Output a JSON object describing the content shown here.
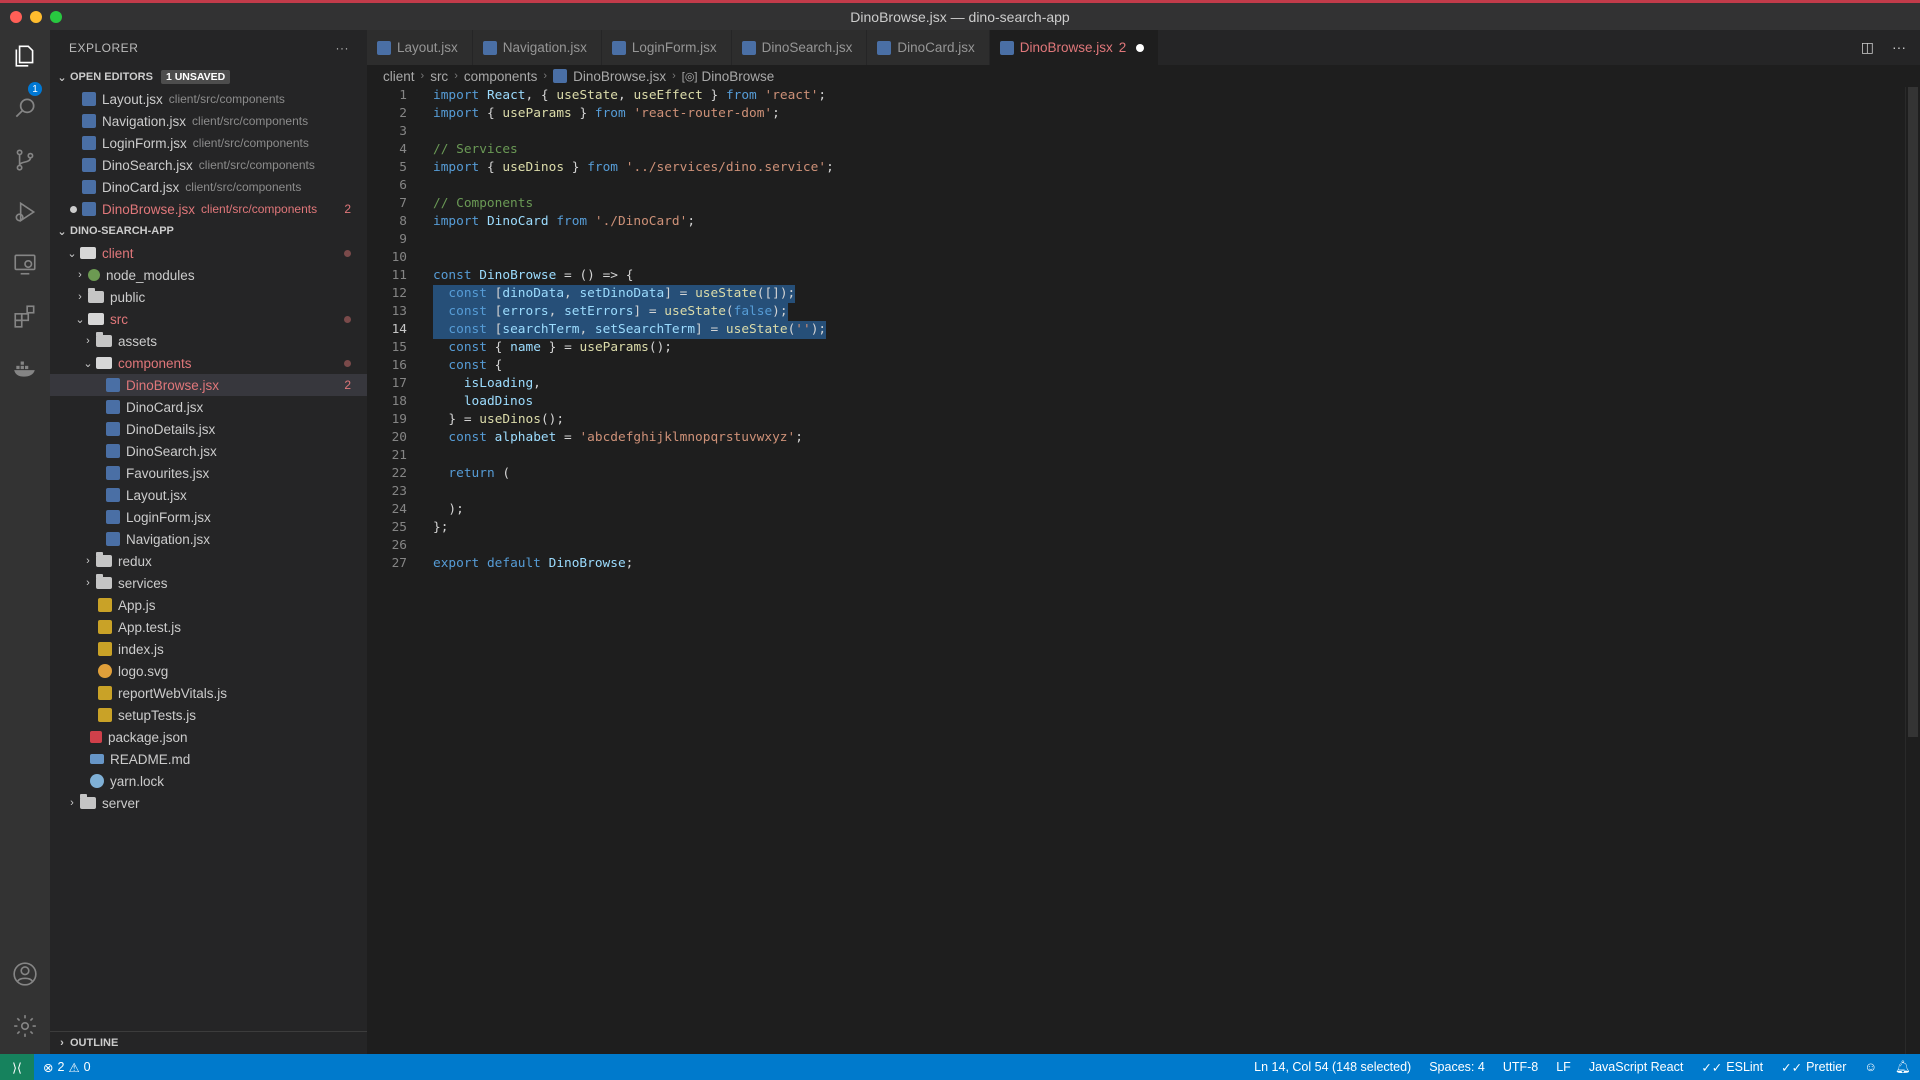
{
  "window": {
    "title": "DinoBrowse.jsx — dino-search-app"
  },
  "colors": {
    "accent": "#007acc",
    "modified": "#e0777a",
    "selection": "#264f78",
    "titlebar_border": "#c23b4a"
  },
  "activity_bar": {
    "explorer_badge": "1",
    "icons": [
      "files-icon",
      "search-icon",
      "source-control-icon",
      "run-debug-icon",
      "remote-explorer-icon",
      "extensions-icon",
      "docker-icon",
      "account-icon",
      "settings-gear-icon"
    ]
  },
  "sidebar": {
    "title": "EXPLORER",
    "more": "···",
    "open_editors": {
      "label": "OPEN EDITORS",
      "badge": "1 UNSAVED",
      "items": [
        {
          "name": "Layout.jsx",
          "path": "client/src/components"
        },
        {
          "name": "Navigation.jsx",
          "path": "client/src/components"
        },
        {
          "name": "LoginForm.jsx",
          "path": "client/src/components"
        },
        {
          "name": "DinoSearch.jsx",
          "path": "client/src/components"
        },
        {
          "name": "DinoCard.jsx",
          "path": "client/src/components"
        },
        {
          "name": "DinoBrowse.jsx",
          "path": "client/src/components",
          "problems": "2"
        }
      ]
    },
    "project": {
      "label": "DINO-SEARCH-APP",
      "tree": [
        {
          "name": "client"
        },
        {
          "name": "node_modules"
        },
        {
          "name": "public"
        },
        {
          "name": "src"
        },
        {
          "name": "assets"
        },
        {
          "name": "components"
        },
        {
          "name": "DinoBrowse.jsx",
          "problems": "2"
        },
        {
          "name": "DinoCard.jsx"
        },
        {
          "name": "DinoDetails.jsx"
        },
        {
          "name": "DinoSearch.jsx"
        },
        {
          "name": "Favourites.jsx"
        },
        {
          "name": "Layout.jsx"
        },
        {
          "name": "LoginForm.jsx"
        },
        {
          "name": "Navigation.jsx"
        },
        {
          "name": "redux"
        },
        {
          "name": "services"
        },
        {
          "name": "App.js"
        },
        {
          "name": "App.test.js"
        },
        {
          "name": "index.js"
        },
        {
          "name": "logo.svg"
        },
        {
          "name": "reportWebVitals.js"
        },
        {
          "name": "setupTests.js"
        },
        {
          "name": "package.json"
        },
        {
          "name": "README.md"
        },
        {
          "name": "yarn.lock"
        },
        {
          "name": "server"
        }
      ]
    },
    "outline": {
      "label": "OUTLINE"
    }
  },
  "tabs": [
    {
      "label": "Layout.jsx"
    },
    {
      "label": "Navigation.jsx"
    },
    {
      "label": "LoginForm.jsx"
    },
    {
      "label": "DinoSearch.jsx"
    },
    {
      "label": "DinoCard.jsx"
    },
    {
      "label": "DinoBrowse.jsx",
      "count": "2",
      "active": true
    }
  ],
  "breadcrumb": [
    "client",
    "src",
    "components",
    "DinoBrowse.jsx",
    "DinoBrowse"
  ],
  "editor": {
    "line_numbers": [
      "1",
      "2",
      "3",
      "4",
      "5",
      "6",
      "7",
      "8",
      "9",
      "10",
      "11",
      "12",
      "13",
      "14",
      "15",
      "16",
      "17",
      "18",
      "19",
      "20",
      "21",
      "22",
      "23",
      "24",
      "25",
      "26",
      "27"
    ],
    "lines": [
      "import React, { useState, useEffect } from 'react';",
      "import { useParams } from 'react-router-dom';",
      "",
      "// Services",
      "import { useDinos } from '../services/dino.service';",
      "",
      "// Components",
      "import DinoCard from './DinoCard';",
      "",
      "",
      "const DinoBrowse = () => {",
      "  const [dinoData, setDinoData] = useState([]);",
      "  const [errors, setErrors] = useState(false);",
      "  const [searchTerm, setSearchTerm] = useState('');",
      "  const { name } = useParams();",
      "  const {",
      "    isLoading,",
      "    loadDinos",
      "  } = useDinos();",
      "  const alphabet = 'abcdefghijklmnopqrstuvwxyz';",
      "",
      "  return (",
      "",
      "  );",
      "};",
      "",
      "export default DinoBrowse;"
    ]
  },
  "status_bar": {
    "errors": "2",
    "warnings": "0",
    "cursor": "Ln 14, Col 54 (148 selected)",
    "spaces": "Spaces: 4",
    "encoding": "UTF-8",
    "eol": "LF",
    "language": "JavaScript React",
    "eslint": "ESLint",
    "prettier": "Prettier"
  }
}
